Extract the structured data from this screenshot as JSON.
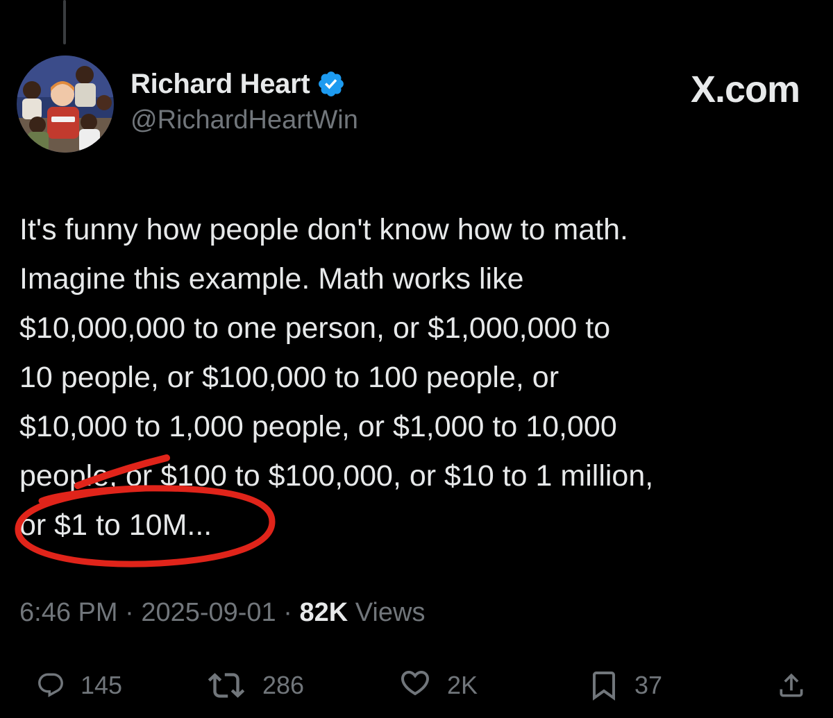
{
  "author": {
    "display_name": "Richard Heart",
    "handle": "@RichardHeartWin",
    "verified": true
  },
  "brand": "X.com",
  "tweet": {
    "text": "It's funny how people don't know how to math.\nImagine this example. Math works like\n$10,000,000 to one person, or $1,000,000 to\n10 people, or $100,000 to 100 people, or\n$10,000 to 1,000 people, or $1,000 to 10,000\npeople, or $100 to $100,000, or $10 to 1 million,\nor $1 to 10M..."
  },
  "meta": {
    "time": "6:46 PM",
    "separator": " · ",
    "date": "2025-09-01",
    "views_count": "82K",
    "views_label": "Views"
  },
  "actions": {
    "replies": "145",
    "reposts": "286",
    "likes": "2K",
    "bookmarks": "37"
  },
  "icons": {
    "verified": "verified-badge-icon",
    "reply": "reply-bubble-icon",
    "repost": "repost-icon",
    "like": "heart-icon",
    "bookmark": "bookmark-icon",
    "share": "share-icon"
  },
  "colors": {
    "background": "#000000",
    "text_primary": "#e7e9ea",
    "text_secondary": "#71767b",
    "verified_blue": "#1d9bf0",
    "annotation_red": "#e0241a"
  }
}
